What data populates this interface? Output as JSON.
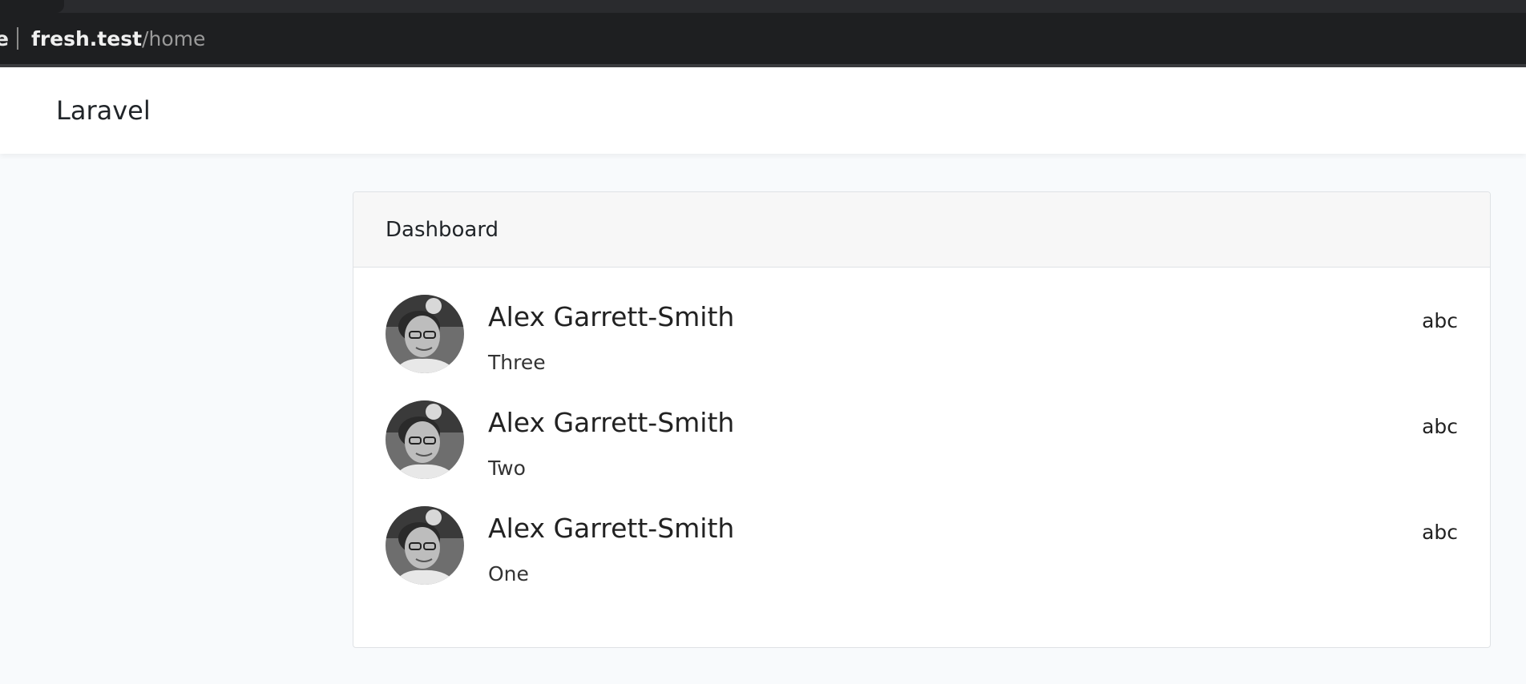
{
  "browser": {
    "url_cut_text": "e",
    "url_host": "fresh.test",
    "url_path": "/home"
  },
  "navbar": {
    "brand": "Laravel"
  },
  "card": {
    "title": "Dashboard",
    "items": [
      {
        "name": "Alex Garrett-Smith",
        "text": "Three",
        "tag": "abc"
      },
      {
        "name": "Alex Garrett-Smith",
        "text": "Two",
        "tag": "abc"
      },
      {
        "name": "Alex Garrett-Smith",
        "text": "One",
        "tag": "abc"
      }
    ]
  }
}
